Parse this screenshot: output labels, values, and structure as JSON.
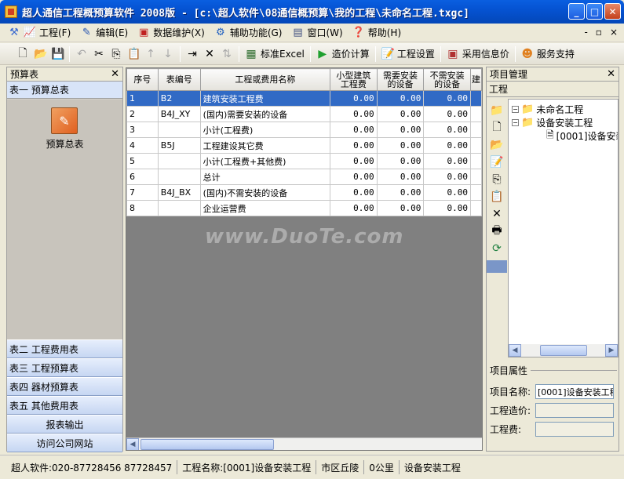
{
  "window": {
    "title": "超人通信工程概预算软件  2008版  -  [c:\\超人软件\\08通信概预算\\我的工程\\未命名工程.txgc]"
  },
  "menu": {
    "items": [
      {
        "label": "工程(F)",
        "icon": "project-icon"
      },
      {
        "label": "编辑(E)",
        "icon": "edit-icon"
      },
      {
        "label": "数据维护(X)",
        "icon": "database-icon"
      },
      {
        "label": "辅助功能(G)",
        "icon": "tools-icon"
      },
      {
        "label": "窗口(W)",
        "icon": "window-icon"
      },
      {
        "label": "帮助(H)",
        "icon": "help-icon"
      }
    ],
    "right_controls": [
      "-",
      "▫",
      "×"
    ]
  },
  "toolbar": {
    "excel_label": "标准Excel",
    "calc_label": "造价计算",
    "settings_label": "工程设置",
    "info_price_label": "采用信息价",
    "support_label": "服务支持"
  },
  "left_panel": {
    "header": "预算表",
    "top_item": "表一  预算总表",
    "summary_label": "预算总表",
    "bottom_items": [
      "表二  工程费用表",
      "表三  工程预算表",
      "表四  器材预算表",
      "表五  其他费用表",
      "报表输出",
      "访问公司网站"
    ]
  },
  "grid": {
    "columns": [
      "序号",
      "表编号",
      "工程或费用名称",
      "小型建筑\n工程费",
      "需要安装\n的设备",
      "不需安装\n的设备",
      "建"
    ],
    "rows": [
      {
        "seq": "1",
        "code": "B2",
        "name": "建筑安装工程费",
        "v1": "0.00",
        "v2": "0.00",
        "v3": "0.00"
      },
      {
        "seq": "2",
        "code": "B4J_XY",
        "name": "(国内)需要安装的设备",
        "v1": "0.00",
        "v2": "0.00",
        "v3": "0.00"
      },
      {
        "seq": "3",
        "code": "",
        "name": "小计(工程费)",
        "v1": "0.00",
        "v2": "0.00",
        "v3": "0.00"
      },
      {
        "seq": "4",
        "code": "B5J",
        "name": "工程建设其它费",
        "v1": "0.00",
        "v2": "0.00",
        "v3": "0.00"
      },
      {
        "seq": "5",
        "code": "",
        "name": "小计(工程费+其他费)",
        "v1": "0.00",
        "v2": "0.00",
        "v3": "0.00"
      },
      {
        "seq": "6",
        "code": "",
        "name": "总计",
        "v1": "0.00",
        "v2": "0.00",
        "v3": "0.00"
      },
      {
        "seq": "7",
        "code": "B4J_BX",
        "name": "(国内)不需安装的设备",
        "v1": "0.00",
        "v2": "0.00",
        "v3": "0.00"
      },
      {
        "seq": "8",
        "code": "",
        "name": "企业运营费",
        "v1": "0.00",
        "v2": "0.00",
        "v3": "0.00"
      }
    ],
    "watermark": "www.DuoTe.com"
  },
  "right_panel": {
    "header": "项目管理",
    "sub_header": "工程",
    "tree": {
      "root": "未命名工程",
      "child": "设备安装工程",
      "leaf": "[0001]设备安装"
    },
    "props": {
      "legend": "项目属性",
      "name_label": "项目名称:",
      "name_value": "[0001]设备安装工程",
      "cost_label": "工程造价:",
      "cost_value": "",
      "fee_label": "工程费:",
      "fee_value": ""
    }
  },
  "statusbar": {
    "company": "超人软件:020-87728456  87728457",
    "project": "工程名称:[0001]设备安装工程",
    "region": "市区丘陵",
    "distance": "0公里",
    "type": "设备安装工程"
  }
}
